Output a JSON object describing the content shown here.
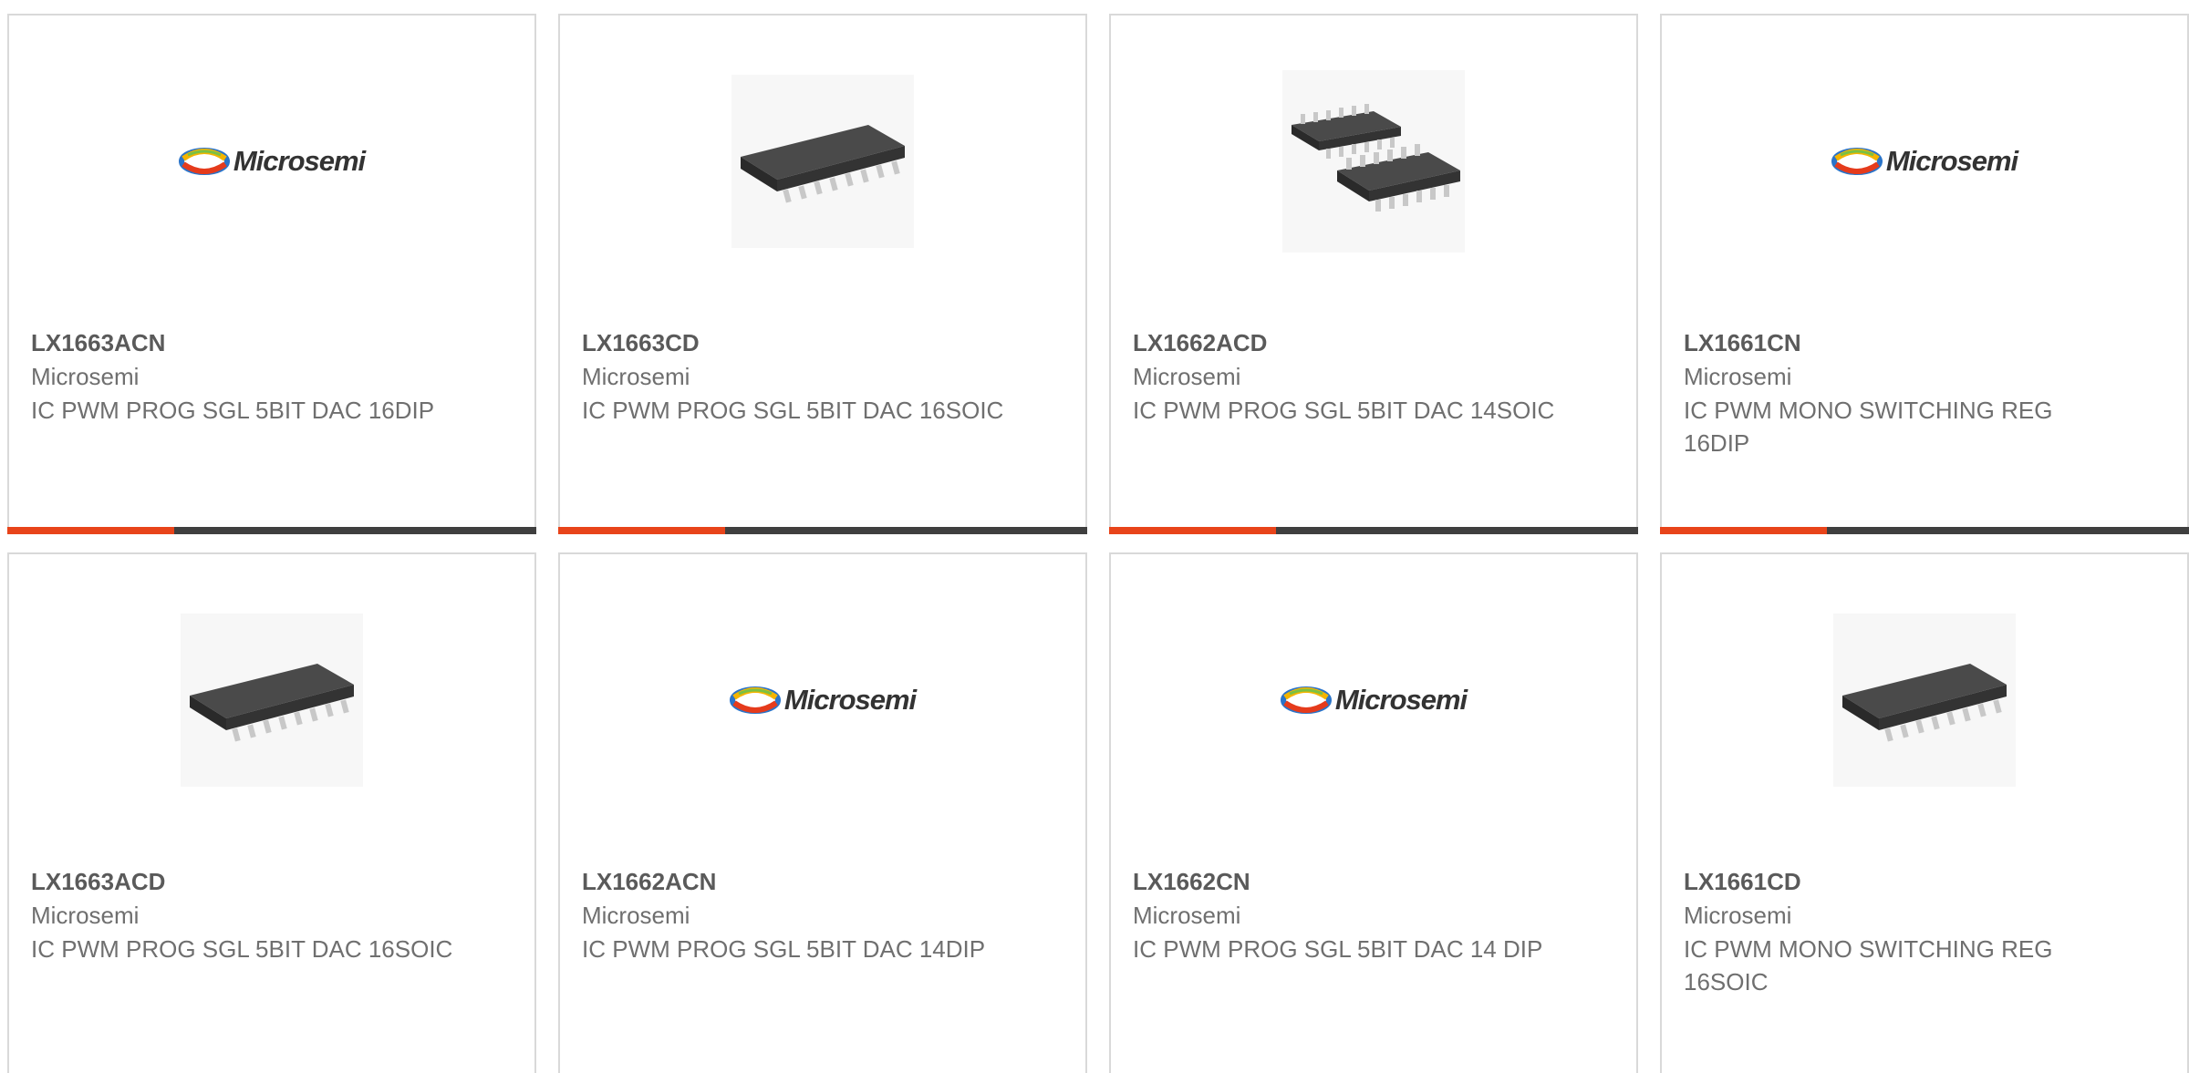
{
  "products": [
    {
      "part": "LX1663ACN",
      "manufacturer": "Microsemi",
      "description": "IC PWM PROG SGL 5BIT DAC 16DIP",
      "image": "microsemi-logo",
      "logo_text": "Microsemi"
    },
    {
      "part": "LX1663CD",
      "manufacturer": "Microsemi",
      "description": "IC PWM PROG SGL 5BIT DAC 16SOIC",
      "image": "soic-chip"
    },
    {
      "part": "LX1662ACD",
      "manufacturer": "Microsemi",
      "description": "IC PWM PROG SGL 5BIT DAC 14SOIC",
      "image": "two-soic-chips"
    },
    {
      "part": "LX1661CN",
      "manufacturer": "Microsemi",
      "description": "IC PWM MONO SWITCHING REG 16DIP",
      "image": "microsemi-logo",
      "logo_text": "Microsemi"
    },
    {
      "part": "LX1663ACD",
      "manufacturer": "Microsemi",
      "description": "IC PWM PROG SGL 5BIT DAC 16SOIC",
      "image": "soic-chip"
    },
    {
      "part": "LX1662ACN",
      "manufacturer": "Microsemi",
      "description": "IC PWM PROG SGL 5BIT DAC 14DIP",
      "image": "microsemi-logo",
      "logo_text": "Microsemi"
    },
    {
      "part": "LX1662CN",
      "manufacturer": "Microsemi",
      "description": "IC PWM PROG SGL 5BIT DAC 14 DIP",
      "image": "microsemi-logo",
      "logo_text": "Microsemi"
    },
    {
      "part": "LX1661CD",
      "manufacturer": "Microsemi",
      "description": "IC PWM MONO SWITCHING REG 16SOIC",
      "image": "soic-chip"
    }
  ],
  "colors": {
    "accent": "#e8441a",
    "bar_dark": "#3f3f3f",
    "border": "#d9d9d9",
    "part_text": "#5a5a5a",
    "body_text": "#6f6f6f"
  }
}
